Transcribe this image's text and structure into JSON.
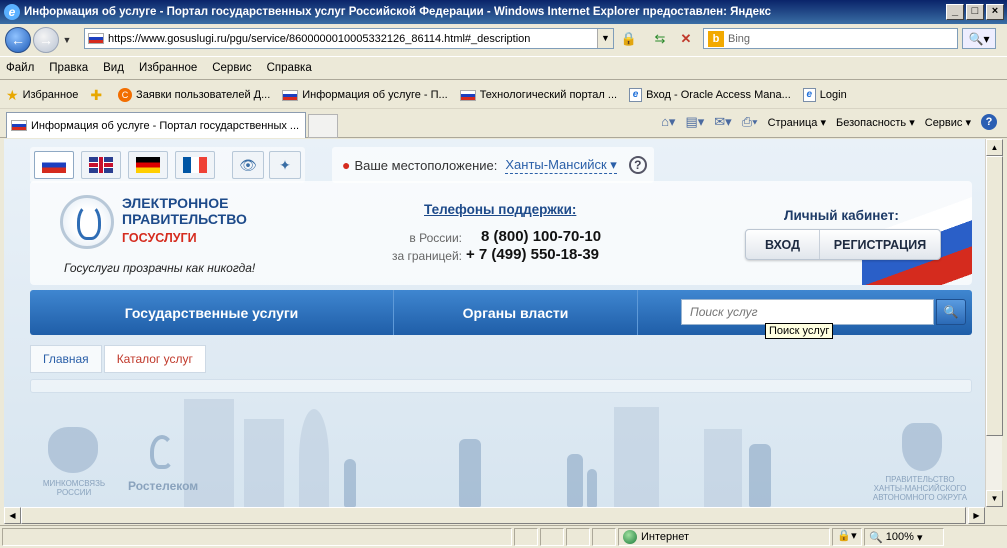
{
  "window": {
    "title": "Информация об услуге - Портал государственных услуг Российской Федерации - Windows Internet Explorer предоставлен: Яндекс"
  },
  "address": {
    "url": "https://www.gosuslugi.ru/pgu/service/8600000010005332126_86114.html#_description",
    "search_placeholder": "Bing"
  },
  "menu": [
    "Файл",
    "Правка",
    "Вид",
    "Избранное",
    "Сервис",
    "Справка"
  ],
  "favorites": {
    "label": "Избранное",
    "items": [
      "Заявки пользователей  Д...",
      "Информация об услуге - П...",
      "Технологический портал ...",
      "Вход - Oracle Access Mana...",
      "Login"
    ]
  },
  "tab": {
    "label": "Информация об услуге - Портал государственных ..."
  },
  "commandbar": {
    "page": "Страница",
    "security": "Безопасность",
    "tools": "Сервис"
  },
  "site": {
    "location_label": "Ваше местоположение:",
    "location_city": "Ханты-Мансийск",
    "logo_line1": "ЭЛЕКТРОННОЕ",
    "logo_line2": "ПРАВИТЕЛЬСТВО",
    "logo_line3": "ГОСУСЛУГИ",
    "slogan": "Госуслуги прозрачны как никогда!",
    "phones_title": "Телефоны поддержки",
    "phones": [
      {
        "label": "в России:",
        "number": "8 (800) 100-70-10"
      },
      {
        "label": "за границей:",
        "number": "+ 7 (499) 550-18-39"
      }
    ],
    "cabinet_title": "Личный кабинет:",
    "login_button": "ВХОД",
    "register_button": "РЕГИСТРАЦИЯ",
    "nav": [
      "Государственные услуги",
      "Органы власти"
    ],
    "search_placeholder": "Поиск услуг",
    "tooltip": "Поиск услуг",
    "breadcrumb_home": "Главная",
    "breadcrumb_current": "Каталог услуг",
    "footer_minsvyaz": "МИНКОМСВЯЗЬ РОССИИ",
    "footer_rostelecom": "Ростелеком",
    "footer_hmao": "ПРАВИТЕЛЬСТВО ХАНТЫ-МАНСИЙСКОГО АВТОНОМНОГО ОКРУГА"
  },
  "status": {
    "zone": "Интернет",
    "zoom": "100%"
  }
}
